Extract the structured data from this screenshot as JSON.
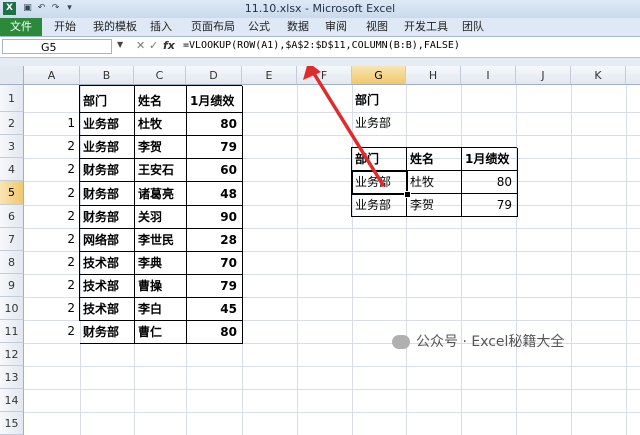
{
  "window": {
    "title": "11.10.xlsx - Microsoft Excel",
    "app_icon": "excel-logo"
  },
  "quick_access": [
    "save-icon",
    "undo-icon",
    "redo-icon",
    "customize-icon"
  ],
  "ribbon": {
    "file_tab": "文件",
    "tabs": [
      "开始",
      "我的模板",
      "插入",
      "页面布局",
      "公式",
      "数据",
      "审阅",
      "视图",
      "开发工具",
      "团队"
    ]
  },
  "formula_bar": {
    "name_box": "G5",
    "fx": "fx",
    "formula": "=VLOOKUP(ROW(A1),$A$2:$D$11,COLUMN(B:B),FALSE)"
  },
  "columns": [
    "A",
    "B",
    "C",
    "D",
    "E",
    "F",
    "G",
    "H",
    "I",
    "J",
    "K"
  ],
  "rows": [
    "1",
    "2",
    "3",
    "4",
    "5",
    "6",
    "7",
    "8",
    "9",
    "10",
    "11",
    "12",
    "13",
    "14",
    "15"
  ],
  "active": {
    "column": "G",
    "row": "5"
  },
  "source_table": {
    "headers": [
      "部门",
      "姓名",
      "1月绩效"
    ],
    "rows": [
      {
        "a": "1",
        "dept": "业务部",
        "name": "杜牧",
        "score": "80"
      },
      {
        "a": "2",
        "dept": "业务部",
        "name": "李贺",
        "score": "79"
      },
      {
        "a": "2",
        "dept": "财务部",
        "name": "王安石",
        "score": "60"
      },
      {
        "a": "2",
        "dept": "财务部",
        "name": "诸葛亮",
        "score": "48"
      },
      {
        "a": "2",
        "dept": "财务部",
        "name": "关羽",
        "score": "90"
      },
      {
        "a": "2",
        "dept": "网络部",
        "name": "李世民",
        "score": "28"
      },
      {
        "a": "2",
        "dept": "技术部",
        "name": "李典",
        "score": "70"
      },
      {
        "a": "2",
        "dept": "技术部",
        "name": "曹操",
        "score": "79"
      },
      {
        "a": "2",
        "dept": "技术部",
        "name": "李白",
        "score": "45"
      },
      {
        "a": "2",
        "dept": "财务部",
        "name": "曹仁",
        "score": "80"
      }
    ]
  },
  "lookup": {
    "label": "部门",
    "value": "业务部",
    "headers": [
      "部门",
      "姓名",
      "1月绩效"
    ],
    "rows": [
      {
        "dept": "业务部",
        "name": "杜牧",
        "score": "80"
      },
      {
        "dept": "业务部",
        "name": "李贺",
        "score": "79"
      }
    ]
  },
  "annotation": {
    "color": "#e02b2b"
  },
  "watermark": {
    "text": "公众号 · Excel秘籍大全"
  }
}
